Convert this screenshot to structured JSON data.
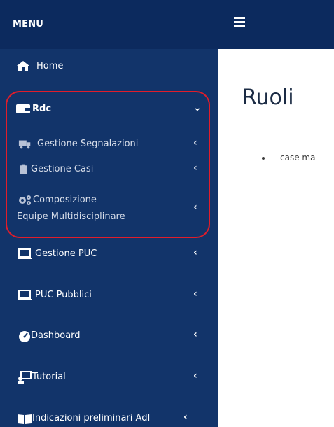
{
  "sidebar": {
    "menu_title": "MENU",
    "items": [
      {
        "label": "Home",
        "icon": "home-icon"
      },
      {
        "label": "Rdc",
        "icon": "wallet-icon",
        "expanded": true
      },
      {
        "label": "Gestione Segnalazioni",
        "icon": "truck-icon"
      },
      {
        "label": "Gestione Casi",
        "icon": "clipboard-icon"
      },
      {
        "label": "Composizione",
        "label2": "Equipe Multidisciplinare",
        "icon": "cogs-icon"
      },
      {
        "label": "Gestione PUC",
        "icon": "laptop-icon"
      },
      {
        "label": "PUC Pubblici",
        "icon": "laptop-icon"
      },
      {
        "label": "Dashboard",
        "icon": "dashboard-icon"
      },
      {
        "label": "Tutorial",
        "icon": "tutorial-icon"
      },
      {
        "label": "Indicazioni preliminari AdI",
        "icon": "book-icon"
      }
    ]
  },
  "topbar": {
    "menu_toggle": "hamburger-icon"
  },
  "main": {
    "title": "Ruoli",
    "bullets": [
      "case ma"
    ]
  },
  "colors": {
    "sidebar": "#12346a",
    "header": "#0c2a5e",
    "highlight": "#e11d2a"
  }
}
